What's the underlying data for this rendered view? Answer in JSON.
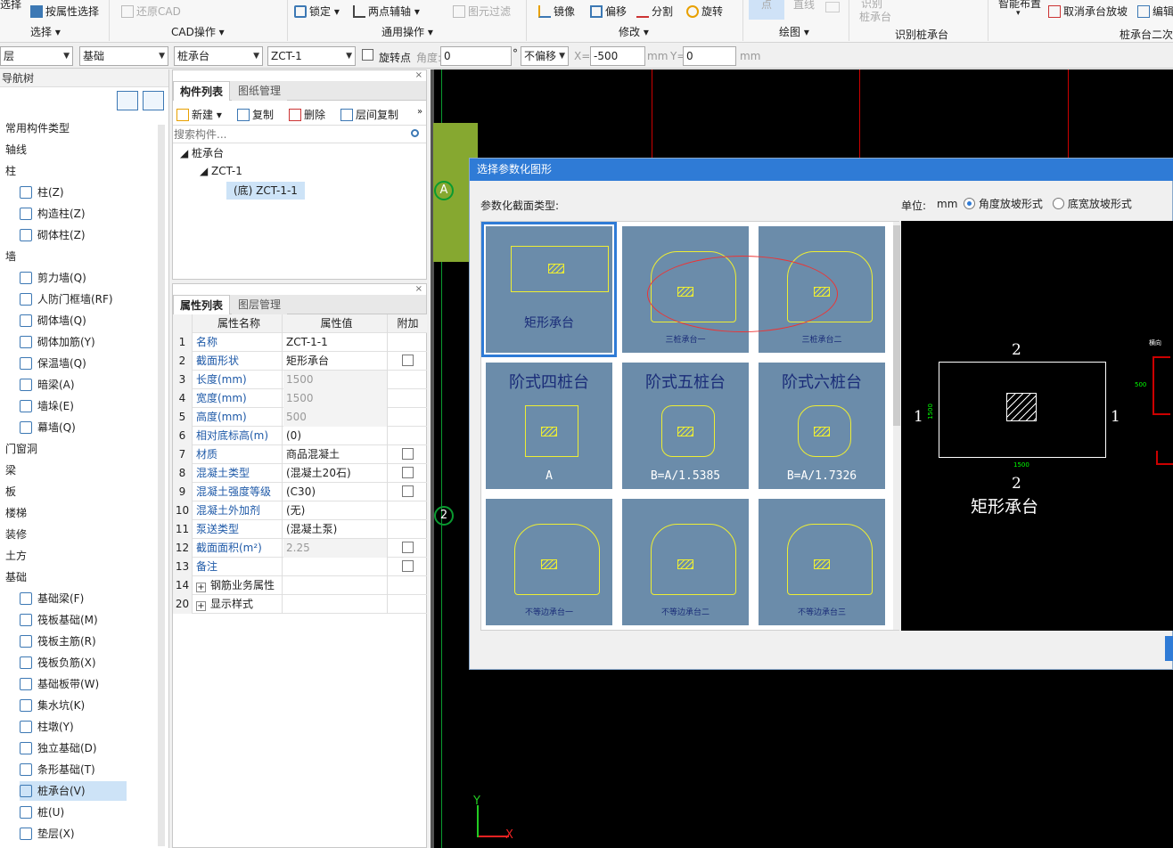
{
  "ribbon": {
    "buttons": {
      "attr_select": "按属性选择",
      "restore_cad": "还原CAD",
      "lock": "锁定",
      "two_point_axis": "两点辅轴",
      "layer_filter": "图元过滤",
      "mirror": "镜像",
      "offset": "偏移",
      "split": "分割",
      "rotate": "旋转",
      "point": "点",
      "line": "直线",
      "identify_top": "识别",
      "identify_bottom": "桩承台",
      "smart_place": "智能布置",
      "cancel_cap_slope": "取消承台放坡",
      "edit": "编辑",
      "select_top": "选择"
    },
    "groups": {
      "select": "选择",
      "cad_ops": "CAD操作",
      "general_ops": "通用操作",
      "modify": "修改",
      "draw": "绘图",
      "identify_cap": "识别桩承台",
      "cap_secondary": "桩承台二次"
    }
  },
  "toolbar2": {
    "floor": "层",
    "category": "基础",
    "component_type": "桩承台",
    "component": "ZCT-1",
    "rotate_point": "旋转点",
    "angle_label": "角度:",
    "angle_value": "0",
    "degree": "°",
    "offset_mode": "不偏移",
    "x_label": "X=",
    "x_value": "-500",
    "x_unit": "mm",
    "y_label": "Y=",
    "y_value": "0",
    "y_unit": "mm"
  },
  "nav": {
    "title": "导航树",
    "items": [
      {
        "label": "常用构件类型",
        "type": "cat"
      },
      {
        "label": "轴线",
        "type": "cat"
      },
      {
        "label": "柱",
        "type": "cat"
      },
      {
        "label": "柱(Z)",
        "type": "sub"
      },
      {
        "label": "构造柱(Z)",
        "type": "sub"
      },
      {
        "label": "砌体柱(Z)",
        "type": "sub"
      },
      {
        "label": "墙",
        "type": "cat"
      },
      {
        "label": "剪力墙(Q)",
        "type": "sub"
      },
      {
        "label": "人防门框墙(RF)",
        "type": "sub"
      },
      {
        "label": "砌体墙(Q)",
        "type": "sub"
      },
      {
        "label": "砌体加筋(Y)",
        "type": "sub"
      },
      {
        "label": "保温墙(Q)",
        "type": "sub"
      },
      {
        "label": "暗梁(A)",
        "type": "sub"
      },
      {
        "label": "墙垛(E)",
        "type": "sub"
      },
      {
        "label": "幕墙(Q)",
        "type": "sub"
      },
      {
        "label": "门窗洞",
        "type": "cat"
      },
      {
        "label": "梁",
        "type": "cat"
      },
      {
        "label": "板",
        "type": "cat"
      },
      {
        "label": "楼梯",
        "type": "cat"
      },
      {
        "label": "装修",
        "type": "cat"
      },
      {
        "label": "土方",
        "type": "cat"
      },
      {
        "label": "基础",
        "type": "cat"
      },
      {
        "label": "基础梁(F)",
        "type": "sub"
      },
      {
        "label": "筏板基础(M)",
        "type": "sub"
      },
      {
        "label": "筏板主筋(R)",
        "type": "sub"
      },
      {
        "label": "筏板负筋(X)",
        "type": "sub"
      },
      {
        "label": "基础板带(W)",
        "type": "sub"
      },
      {
        "label": "集水坑(K)",
        "type": "sub"
      },
      {
        "label": "柱墩(Y)",
        "type": "sub"
      },
      {
        "label": "独立基础(D)",
        "type": "sub"
      },
      {
        "label": "条形基础(T)",
        "type": "sub"
      },
      {
        "label": "桩承台(V)",
        "type": "sub",
        "selected": true
      },
      {
        "label": "桩(U)",
        "type": "sub"
      },
      {
        "label": "垫层(X)",
        "type": "sub"
      }
    ]
  },
  "component_panel": {
    "tab_active": "构件列表",
    "tab_other": "图纸管理",
    "new": "新建",
    "copy": "复制",
    "delete": "删除",
    "floor_copy": "层间复制",
    "search_placeholder": "搜索构件...",
    "tree": {
      "root": "桩承台",
      "child": "ZCT-1",
      "leaf": "(底) ZCT-1-1"
    }
  },
  "property_panel": {
    "tab_active": "属性列表",
    "tab_other": "图层管理",
    "col_name": "属性名称",
    "col_value": "属性值",
    "col_extra": "附加",
    "rows": [
      {
        "n": "1",
        "k": "名称",
        "v": "ZCT-1-1",
        "cb": false,
        "gray": false
      },
      {
        "n": "2",
        "k": "截面形状",
        "v": "矩形承台",
        "cb": true,
        "gray": false
      },
      {
        "n": "3",
        "k": "长度(mm)",
        "v": "1500",
        "cb": false,
        "gray": true
      },
      {
        "n": "4",
        "k": "宽度(mm)",
        "v": "1500",
        "cb": false,
        "gray": true
      },
      {
        "n": "5",
        "k": "高度(mm)",
        "v": "500",
        "cb": false,
        "gray": true
      },
      {
        "n": "6",
        "k": "相对底标高(m)",
        "v": "(0)",
        "cb": false,
        "gray": false
      },
      {
        "n": "7",
        "k": "材质",
        "v": "商品混凝土",
        "cb": true,
        "gray": false
      },
      {
        "n": "8",
        "k": "混凝土类型",
        "v": "(混凝土20石)",
        "cb": true,
        "gray": false
      },
      {
        "n": "9",
        "k": "混凝土强度等级",
        "v": "(C30)",
        "cb": true,
        "gray": false
      },
      {
        "n": "10",
        "k": "混凝土外加剂",
        "v": "(无)",
        "cb": false,
        "gray": false
      },
      {
        "n": "11",
        "k": "泵送类型",
        "v": "(混凝土泵)",
        "cb": false,
        "gray": false
      },
      {
        "n": "12",
        "k": "截面面积(m²)",
        "v": "2.25",
        "cb": true,
        "gray": true
      },
      {
        "n": "13",
        "k": "备注",
        "v": "",
        "cb": true,
        "gray": false
      },
      {
        "n": "14",
        "k": "钢筋业务属性",
        "v": "",
        "cb": false,
        "gray": false,
        "group": true
      },
      {
        "n": "20",
        "k": "显示样式",
        "v": "",
        "cb": false,
        "gray": false,
        "group": true
      }
    ]
  },
  "canvas": {
    "axis_a": "A",
    "axis_2": "2",
    "axis_x": "X",
    "axis_y": "Y"
  },
  "dialog": {
    "title": "选择参数化图形",
    "section_label": "参数化截面类型:",
    "unit_label": "单位:",
    "unit_value": "mm",
    "opt_angle": "角度放坡形式",
    "opt_width": "底宽放坡形式",
    "thumbs": [
      {
        "label": "矩形承台"
      },
      {
        "label": "三桩承台一"
      },
      {
        "label": "三桩承台二"
      },
      {
        "label": "阶式四桩台",
        "sub": "A"
      },
      {
        "label": "阶式五桩台",
        "sub": "B=A/1.5385"
      },
      {
        "label": "阶式六桩台",
        "sub": "B=A/1.7326"
      },
      {
        "label": "不等边承台一"
      },
      {
        "label": "不等边承台二"
      },
      {
        "label": "不等边承台三"
      }
    ],
    "preview": {
      "label": "矩形承台",
      "top_num": "2",
      "bottom_num": "2",
      "left_num": "1",
      "right_num": "1",
      "dim_w": "1500",
      "dim_h": "1500",
      "side_dim": "500",
      "side_label": "横向"
    }
  }
}
